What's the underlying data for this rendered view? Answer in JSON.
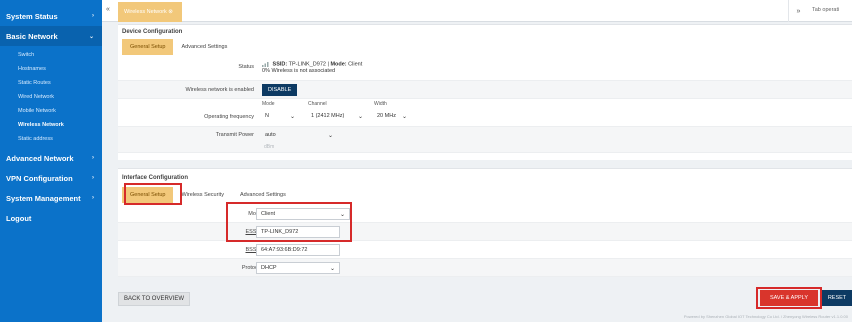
{
  "sidebar": {
    "sections": [
      {
        "label": "System Status",
        "chevron": "›"
      },
      {
        "label": "Basic Network",
        "chevron": "⌄"
      }
    ],
    "subitems": [
      "Switch",
      "Hostnames",
      "Static Routes",
      "Wired Network",
      "Mobile Network",
      "Wireless Network",
      "Static address"
    ],
    "lower_sections": [
      {
        "label": "Advanced Network",
        "chevron": "›"
      },
      {
        "label": "VPN Configuration",
        "chevron": "›"
      },
      {
        "label": "System Management",
        "chevron": "›"
      },
      {
        "label": "Logout",
        "chevron": ""
      }
    ]
  },
  "tabbar": {
    "prev": "«",
    "active_tab": "Wireless Network ⊗",
    "next": "»",
    "ops": "Tab operati"
  },
  "device": {
    "title": "Device Configuration",
    "tabs": [
      "General Setup",
      "Advanced Settings"
    ],
    "status_label": "Status",
    "status_ssid_label": "SSID:",
    "status_ssid": "TP-LINK_D972",
    "status_mode_label": "Mode:",
    "status_mode": "Client",
    "status_signal": "0%",
    "status_assoc": "Wireless is not associated",
    "enabled_label": "Wireless network is enabled",
    "disable_button": "DISABLE",
    "freq_label": "Operating frequency",
    "mode_header": "Mode",
    "channel_header": "Channel",
    "width_header": "Width",
    "mode_value": "N",
    "channel_value": "1 (2412 MHz)",
    "width_value": "20 MHz",
    "power_label": "Transmit Power",
    "power_value": "auto",
    "power_hint": "dBm"
  },
  "iface": {
    "title": "Interface Configuration",
    "tabs": [
      "General Setup",
      "Wireless Security",
      "Advanced Settings"
    ],
    "mode_label": "Mode",
    "mode_value": "Client",
    "essid_label": "ESSID",
    "essid_value": "TP-LINK_D972",
    "bssid_label": "BSSID",
    "bssid_value": "64:A7:93:6B:D9:72",
    "protocol_label": "Protocol",
    "protocol_value": "DHCP"
  },
  "actions": {
    "back": "BACK TO OVERVIEW",
    "save": "SAVE & APPLY",
    "reset": "RESET"
  },
  "footer": "Powered by Shenzhen Global IOT Technology Co Ltd. / Zhenyong Wireless Router v1.1.0.00",
  "colors": {
    "sidebar": "#0b72c9",
    "accent_tab": "#f2c87a",
    "highlight": "#d62a2a",
    "dark_button": "#0d3a63",
    "save_button": "#d9352c"
  }
}
